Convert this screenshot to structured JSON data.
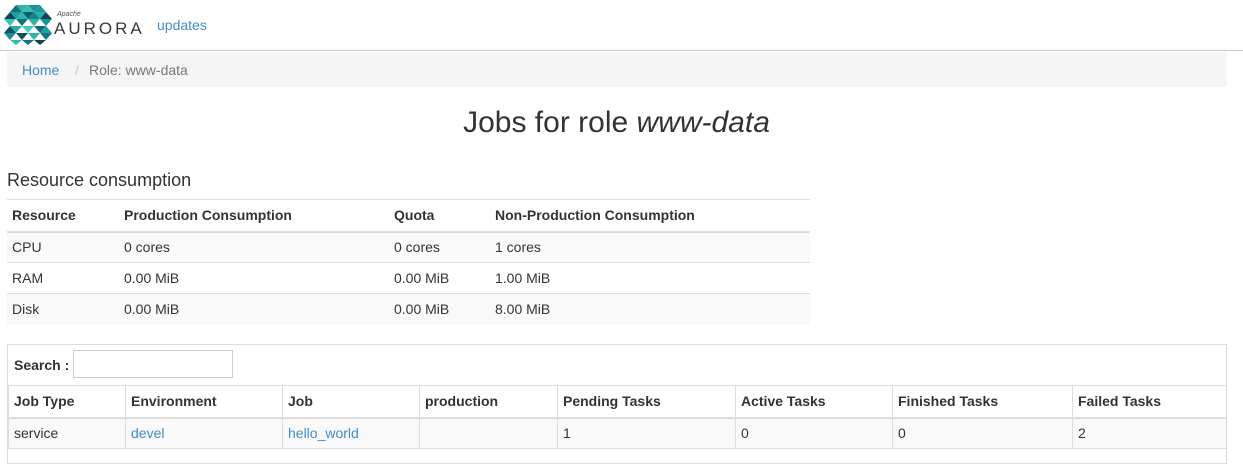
{
  "navbar": {
    "logo_small": "Apache",
    "logo_name": "AURORA",
    "links": [
      "updates"
    ]
  },
  "breadcrumb": {
    "home": "Home",
    "separator": "/",
    "current": "Role: www-data"
  },
  "page": {
    "title_prefix": "Jobs for role",
    "role": "www-data"
  },
  "resources": {
    "title": "Resource consumption",
    "headers": [
      "Resource",
      "Production Consumption",
      "Quota",
      "Non-Production Consumption"
    ],
    "rows": [
      [
        "CPU",
        "0 cores",
        "0 cores",
        "1 cores"
      ],
      [
        "RAM",
        "0.00 MiB",
        "0.00 MiB",
        "1.00 MiB"
      ],
      [
        "Disk",
        "0.00 MiB",
        "0.00 MiB",
        "8.00 MiB"
      ]
    ]
  },
  "jobs": {
    "search_label": "Search :",
    "search_value": "",
    "headers": [
      "Job Type",
      "Environment",
      "Job",
      "production",
      "Pending Tasks",
      "Active Tasks",
      "Finished Tasks",
      "Failed Tasks"
    ],
    "rows": [
      {
        "job_type": "service",
        "environment": "devel",
        "job": "hello_world",
        "production": "",
        "pending": "1",
        "active": "0",
        "finished": "0",
        "failed": "2"
      }
    ]
  },
  "colors": {
    "link": "#428bca",
    "logo_teal": "#1aa39c",
    "logo_dark": "#0f4f5f"
  }
}
